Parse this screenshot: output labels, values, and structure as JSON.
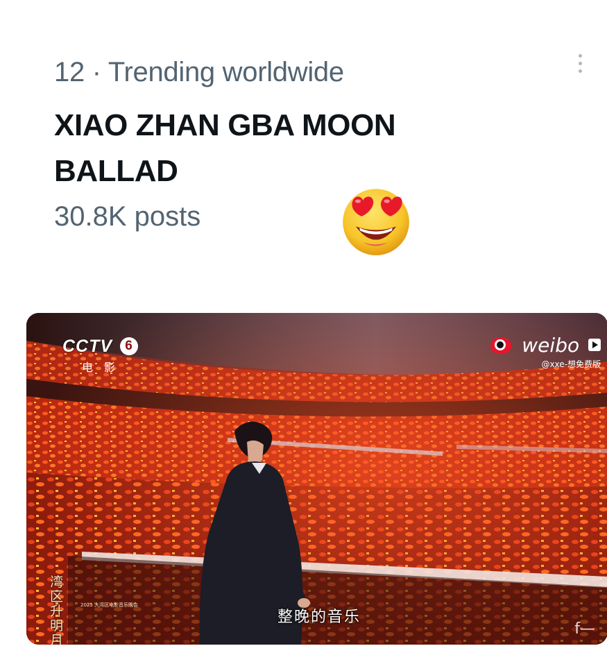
{
  "trend": {
    "rank": "12",
    "separator": "·",
    "context": "Trending worldwide",
    "title": "XIAO ZHAN GBA MOON BALLAD",
    "post_count": "30.8K posts",
    "more_icon": "more-vertical-icon",
    "reaction_emoji": "smiling-face-with-heart-eyes"
  },
  "media": {
    "broadcaster": {
      "logo": "CCTV",
      "channel": "6",
      "subtitle": "电影"
    },
    "watermark": {
      "brand": "weibo",
      "handle": "@xxe-想免费版"
    },
    "caption": "整晚的音乐",
    "event_logo": {
      "title": "湾区升明月",
      "subtitle": "2025 大湾区电影音乐晚会"
    },
    "corner_text": "f—"
  },
  "colors": {
    "meta_gray": "#536471",
    "title_black": "#0f1419",
    "stage_red": "#e0301a",
    "weibo_red": "#e6162d"
  }
}
